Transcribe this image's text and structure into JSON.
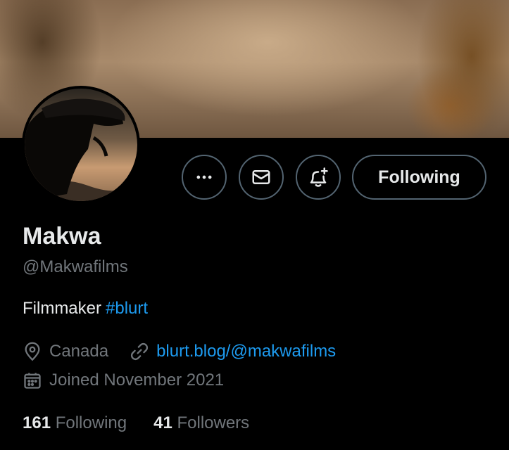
{
  "profile": {
    "name": "Makwa",
    "handle": "@Makwafilms",
    "bio_text": "Filmmaker",
    "bio_hashtag": "#blurt",
    "location": "Canada",
    "website": "blurt.blog/@makwafilms",
    "joined": "Joined November 2021"
  },
  "actions": {
    "more_icon": "more-horizontal-icon",
    "message_icon": "envelope-icon",
    "notify_icon": "bell-plus-icon",
    "follow_label": "Following"
  },
  "stats": {
    "following_count": "161",
    "following_label": "Following",
    "followers_count": "41",
    "followers_label": "Followers"
  },
  "colors": {
    "background": "#000000",
    "text_primary": "#e7e9ea",
    "text_secondary": "#71767b",
    "accent_link": "#1d9bf0",
    "button_border": "#536471"
  }
}
